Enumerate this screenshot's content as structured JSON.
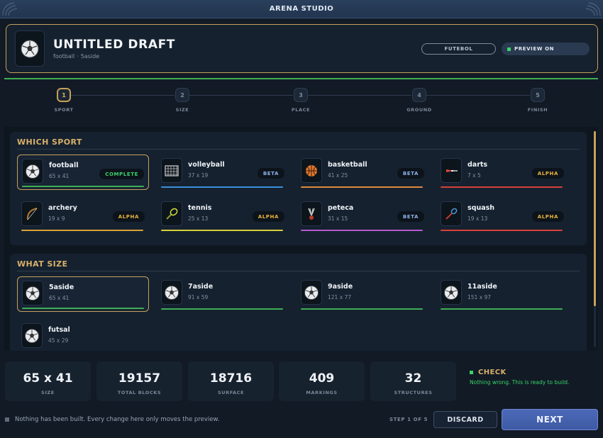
{
  "app": {
    "title": "ARENA STUDIO"
  },
  "header": {
    "title": "UNTITLED DRAFT",
    "sport": "football",
    "size": "5aside",
    "separator": "·",
    "tag": "FUTEBOL",
    "preview": "PREVIEW ON",
    "icon": "football-icon"
  },
  "steps": [
    {
      "num": "1",
      "label": "SPORT",
      "active": true
    },
    {
      "num": "2",
      "label": "SIZE",
      "active": false
    },
    {
      "num": "3",
      "label": "PLACE",
      "active": false
    },
    {
      "num": "4",
      "label": "GROUND",
      "active": false
    },
    {
      "num": "5",
      "label": "FINISH",
      "active": false
    }
  ],
  "sports_section": {
    "heading": "WHICH SPORT",
    "items": [
      {
        "name": "football",
        "dims": "65 x 41",
        "badge": "COMPLETE",
        "badge_color": "#3ad36a",
        "bar_color": "#3fae55",
        "icon": "football-icon",
        "selected": true
      },
      {
        "name": "volleyball",
        "dims": "37 x 19",
        "badge": "BETA",
        "badge_color": "#8fb2e8",
        "bar_color": "#3a8fd9",
        "icon": "volleyball-net-icon",
        "selected": false
      },
      {
        "name": "basketball",
        "dims": "41 x 25",
        "badge": "BETA",
        "badge_color": "#8fb2e8",
        "bar_color": "#e08a3a",
        "icon": "basketball-icon",
        "selected": false
      },
      {
        "name": "darts",
        "dims": "7 x 5",
        "badge": "ALPHA",
        "badge_color": "#e8b53a",
        "bar_color": "#d9413a",
        "icon": "dart-icon",
        "selected": false
      },
      {
        "name": "archery",
        "dims": "19 x 9",
        "badge": "ALPHA",
        "badge_color": "#e8b53a",
        "bar_color": "#d8a23a",
        "icon": "bow-icon",
        "selected": false
      },
      {
        "name": "tennis",
        "dims": "25 x 13",
        "badge": "ALPHA",
        "badge_color": "#e8b53a",
        "bar_color": "#d6d23a",
        "icon": "tennis-racket-icon",
        "selected": false
      },
      {
        "name": "peteca",
        "dims": "31 x 15",
        "badge": "BETA",
        "badge_color": "#8fb2e8",
        "bar_color": "#b35ad0",
        "icon": "shuttlecock-icon",
        "selected": false
      },
      {
        "name": "squash",
        "dims": "19 x 13",
        "badge": "ALPHA",
        "badge_color": "#e8b53a",
        "bar_color": "#d9413a",
        "icon": "squash-racket-icon",
        "selected": false
      }
    ]
  },
  "size_section": {
    "heading": "WHAT SIZE",
    "items": [
      {
        "name": "5aside",
        "dims": "65 x 41",
        "bar_color": "#3fae55",
        "icon": "football-icon",
        "selected": true
      },
      {
        "name": "7aside",
        "dims": "91 x 59",
        "bar_color": "#3fae55",
        "icon": "football-icon",
        "selected": false
      },
      {
        "name": "9aside",
        "dims": "121 x 77",
        "bar_color": "#3fae55",
        "icon": "football-icon",
        "selected": false
      },
      {
        "name": "11aside",
        "dims": "151 x 97",
        "bar_color": "#3fae55",
        "icon": "football-icon",
        "selected": false
      },
      {
        "name": "futsal",
        "dims": "45 x 29",
        "bar_color": "#3fae55",
        "icon": "football-icon",
        "selected": false
      }
    ]
  },
  "stats": [
    {
      "value": "65 x 41",
      "label": "SIZE"
    },
    {
      "value": "19157",
      "label": "TOTAL BLOCKS"
    },
    {
      "value": "18716",
      "label": "SURFACE"
    },
    {
      "value": "409",
      "label": "MARKINGS"
    },
    {
      "value": "32",
      "label": "STRUCTURES"
    }
  ],
  "check": {
    "heading": "CHECK",
    "message": "Nothing wrong. This is ready to build."
  },
  "footer": {
    "note": "Nothing has been built. Every change here only moves the preview.",
    "step_of": "STEP 1 OF 5",
    "discard": "DISCARD",
    "next": "NEXT"
  },
  "colors": {
    "accent": "#c6a15b",
    "ok": "#3ad36a",
    "primary": "#4b69b8"
  }
}
